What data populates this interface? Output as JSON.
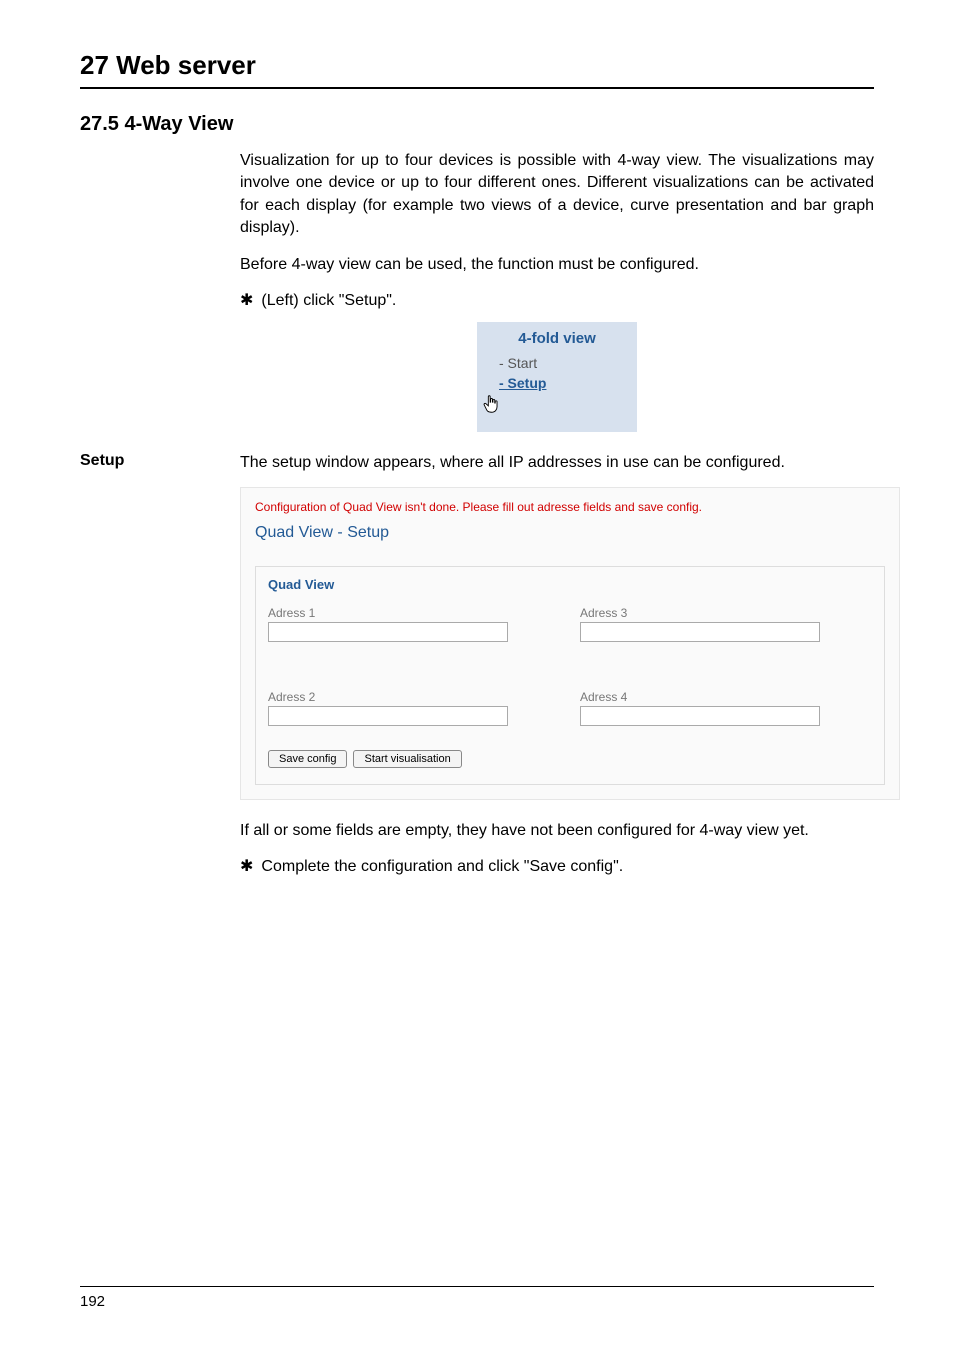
{
  "chapter": {
    "title": "27 Web server"
  },
  "section": {
    "title": "27.5  4-Way View"
  },
  "paragraphs": {
    "p1": "Visualization for up to four devices is possible with 4-way view. The visualizations may involve one device or up to four different ones. Different visualizations can be activated for each display (for example two views of a device, curve presentation and bar graph display).",
    "p2": "Before 4-way view can be used, the function must be configured.",
    "bullet1": "(Left) click \"Setup\".",
    "setup_label": "Setup",
    "setup_text": "The setup window appears, where all IP addresses in use can be configured.",
    "p3": "If all or some fields are empty, they have not been configured for 4-way view yet.",
    "bullet2": "Complete the configuration and click \"Save config\"."
  },
  "nav": {
    "title": "4-fold view",
    "item_start": "- Start",
    "item_setup": "- Setup"
  },
  "quad": {
    "warn": "Configuration of Quad View isn't done. Please fill out adresse fields and save config.",
    "title": "Quad View - Setup",
    "inner_title": "Quad View",
    "addr1_label": "Adress 1",
    "addr2_label": "Adress 2",
    "addr3_label": "Adress 3",
    "addr4_label": "Adress 4",
    "addr1_value": "",
    "addr2_value": "",
    "addr3_value": "",
    "addr4_value": "",
    "save_btn": "Save config",
    "start_btn": "Start visualisation"
  },
  "footer": {
    "page": "192"
  },
  "glyphs": {
    "asterisk": "✱"
  }
}
